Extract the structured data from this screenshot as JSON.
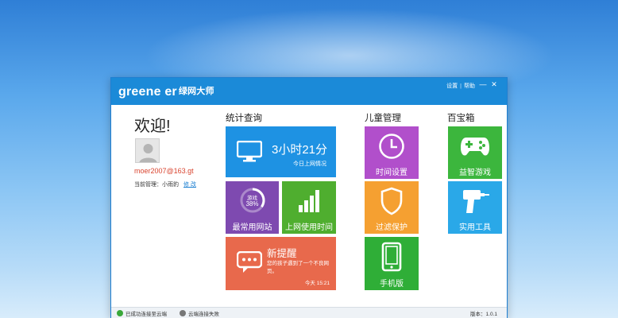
{
  "window": {
    "logo_text": "greene er",
    "logo_cn": "绿网大师",
    "links": {
      "settings": "设置",
      "separator": "|",
      "help": "帮助"
    },
    "minimize": "—",
    "close": "✕"
  },
  "user": {
    "welcome": "欢迎!",
    "email": "moer2007@163.gt",
    "manager_label": "当前管理：小雨豹",
    "edit_link": "修 改"
  },
  "stats": {
    "title": "统计查询",
    "online_time": {
      "value": "3小时21分",
      "caption": "今日上网情况"
    },
    "sites": {
      "gauge_label": "游戏",
      "gauge_pct": "38%",
      "label": "最常用网站"
    },
    "usage": {
      "label": "上网使用时间"
    },
    "reminder": {
      "title": "新提醒",
      "body": "您的孩子遇到了一个不良网页。",
      "time": "今天 15:21"
    }
  },
  "children": {
    "title": "儿童管理",
    "time_settings": "时间设置",
    "filter": "过滤保护",
    "mobile": "手机版"
  },
  "toolbox": {
    "title": "百宝箱",
    "games": "益智游戏",
    "tools": "实用工具"
  },
  "statusbar": {
    "cloud_ok": "已成功连接至云端",
    "cloud_fail": "云端连接失败",
    "version": "版本：1.0.1"
  },
  "colors": {
    "titlebar": "#1b8ad8",
    "time_tile": "#1e92e3",
    "sites_tile": "#7e4ab0",
    "usage_tile": "#4fae2f",
    "reminder_tile": "#e8694c",
    "time_settings_tile": "#b14fcb",
    "filter_tile": "#f5a031",
    "mobile_tile": "#2fae37",
    "games_tile": "#3cb63d",
    "tools_tile": "#2aa8e8"
  },
  "icons": [
    "monitor-icon",
    "bar-chart-icon",
    "chat-bubble-icon",
    "clock-icon",
    "shield-icon",
    "phone-icon",
    "gamepad-icon",
    "drill-icon",
    "avatar-icon",
    "cloud-check-icon",
    "cloud-fail-icon"
  ]
}
